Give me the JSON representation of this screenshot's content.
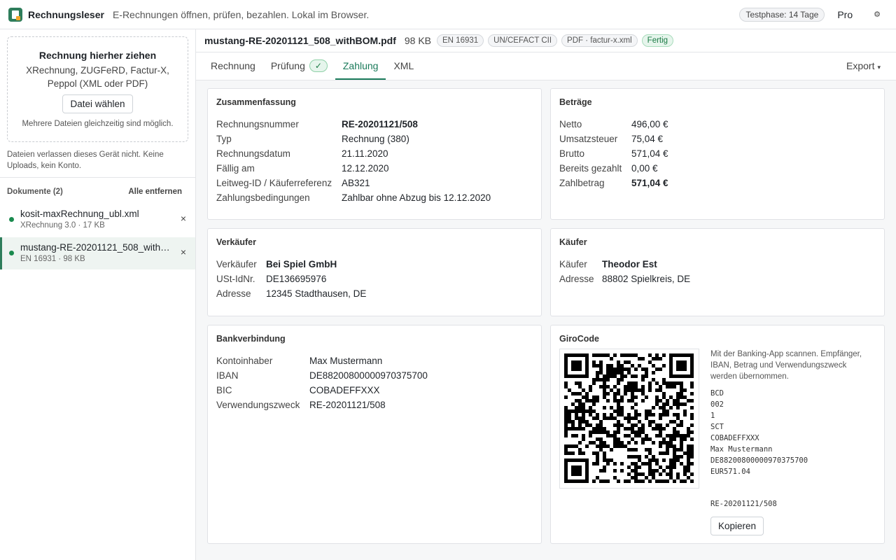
{
  "header": {
    "app_name": "Rechnungsleser",
    "tagline": "E-Rechnungen öffnen, prüfen, bezahlen. Lokal im Browser.",
    "trial_badge": "Testphase: 14 Tage",
    "pro_label": "Pro",
    "settings_icon": "gear-icon"
  },
  "sidebar": {
    "dropzone": {
      "title": "Rechnung hierher ziehen",
      "formats": "XRechnung, ZUGFeRD, Factur-X, Peppol (XML oder PDF)",
      "button_label": "Datei wählen",
      "hint": "Mehrere Dateien gleichzeitig sind möglich."
    },
    "privacy_note": "Dateien verlassen dieses Gerät nicht. Keine Uploads, kein Konto.",
    "documents_title": "Dokumente (2)",
    "remove_all_label": "Alle entfernen",
    "documents": [
      {
        "name": "kosit-maxRechnung_ubl.xml",
        "meta": "XRechnung 3.0 · 17 KB",
        "status_color": "#1a8a4e",
        "close": "×"
      },
      {
        "name": "mustang-RE-20201121_508_withBOM.pdf",
        "meta": "EN 16931 · 98 KB",
        "status_color": "#1a8a4e",
        "close": "×",
        "active": true
      }
    ]
  },
  "file": {
    "name": "mustang-RE-20201121_508_withBOM.pdf",
    "size": "98 KB",
    "chips": [
      "EN 16931",
      "UN/CEFACT CII",
      "PDF · factur-x.xml"
    ],
    "status_chip": "Fertig"
  },
  "tabs": {
    "items": [
      "Rechnung",
      "Prüfung",
      "Zahlung",
      "XML"
    ],
    "active": "Zahlung",
    "check_mark": "✓",
    "export_label": "Export",
    "export_caret": "▾"
  },
  "summary": {
    "title": "Zusammenfassung",
    "rows": [
      {
        "label": "Rechnungsnummer",
        "value": "RE-20201121/508"
      },
      {
        "label": "Typ",
        "value": "Rechnung (380)"
      },
      {
        "label": "Rechnungsdatum",
        "value": "21.11.2020"
      },
      {
        "label": "Fällig am",
        "value": "12.12.2020"
      },
      {
        "label": "Leitweg-ID / Käuferreferenz",
        "value": "AB321"
      },
      {
        "label": "Zahlungsbedingungen",
        "value": "Zahlbar ohne Abzug bis 12.12.2020"
      }
    ]
  },
  "amounts": {
    "title": "Beträge",
    "rows": [
      {
        "label": "Netto",
        "value": "496,00 €"
      },
      {
        "label": "Umsatzsteuer",
        "value": "75,04 €"
      },
      {
        "label": "Brutto",
        "value": "571,04 €"
      },
      {
        "label": "Bereits gezahlt",
        "value": "0,00 €"
      },
      {
        "label": "Zahlbetrag",
        "value": "571,04 €"
      }
    ]
  },
  "seller": {
    "title": "Verkäufer",
    "rows": [
      {
        "label": "Verkäufer",
        "value": "Bei Spiel GmbH"
      },
      {
        "label": "USt-IdNr.",
        "value": "DE136695976"
      },
      {
        "label": "Adresse",
        "value": "12345 Stadthausen, DE"
      }
    ]
  },
  "buyer": {
    "title": "Käufer",
    "rows": [
      {
        "label": "Käufer",
        "value": "Theodor Est"
      },
      {
        "label": "Adresse",
        "value": "88802 Spielkreis, DE"
      }
    ]
  },
  "bank": {
    "title": "Bankverbindung",
    "rows": [
      {
        "label": "Kontoinhaber",
        "value": "Max Mustermann"
      },
      {
        "label": "IBAN",
        "value": "DE88200800000970375700"
      },
      {
        "label": "BIC",
        "value": "COBADEFFXXX"
      },
      {
        "label": "Verwendungszweck",
        "value": "RE-20201121/508"
      }
    ]
  },
  "girocode": {
    "title": "GiroCode",
    "description": "Mit der Banking-App scannen. Empfänger, IBAN, Betrag und Verwendungszweck werden übernommen.",
    "lines": [
      "BCD",
      "002",
      "1",
      "SCT",
      "COBADEFFXXX",
      "Max Mustermann",
      "DE88200800000970375700",
      "EUR571.04"
    ],
    "reference": "RE-20201121/508",
    "copy_label": "Kopieren"
  }
}
